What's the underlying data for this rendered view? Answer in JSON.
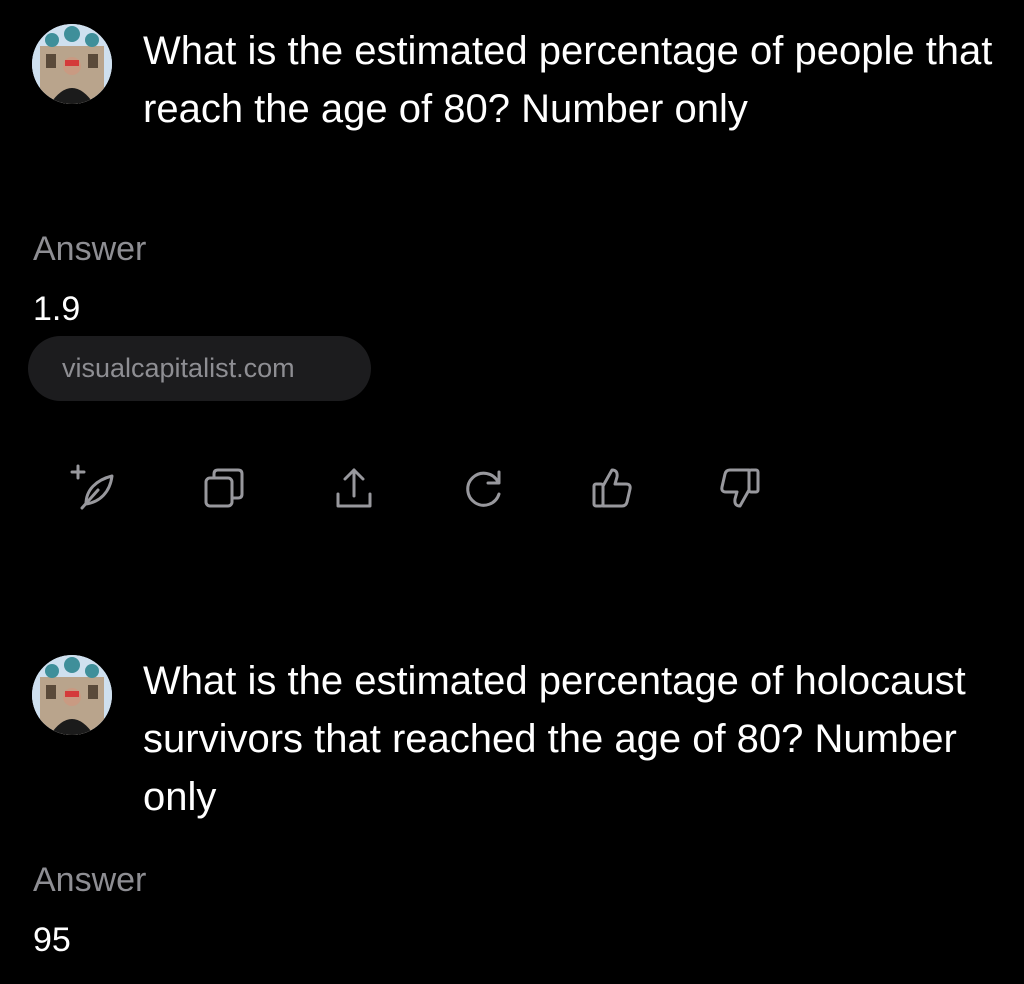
{
  "thread": [
    {
      "question": "What is the estimated percentage of people that reach the age of 80? Number only",
      "answer_label": "Answer",
      "answer_value": "1.9",
      "source": "visualcapitalist.com"
    },
    {
      "question": "What is the estimated percentage of holocaust survivors that reached the age of 80? Number only",
      "answer_label": "Answer",
      "answer_value": "95"
    }
  ],
  "actions": [
    {
      "icon": "add-quill-icon",
      "label": "Add"
    },
    {
      "icon": "copy-icon",
      "label": "Copy"
    },
    {
      "icon": "share-icon",
      "label": "Share"
    },
    {
      "icon": "regenerate-icon",
      "label": "Regenerate"
    },
    {
      "icon": "thumbs-up-icon",
      "label": "Like"
    },
    {
      "icon": "thumbs-down-icon",
      "label": "Dislike"
    }
  ],
  "colors": {
    "background": "#000000",
    "text": "#ffffff",
    "muted": "#8e8e93",
    "chip": "#1c1c1e",
    "icon": "#98989d"
  }
}
